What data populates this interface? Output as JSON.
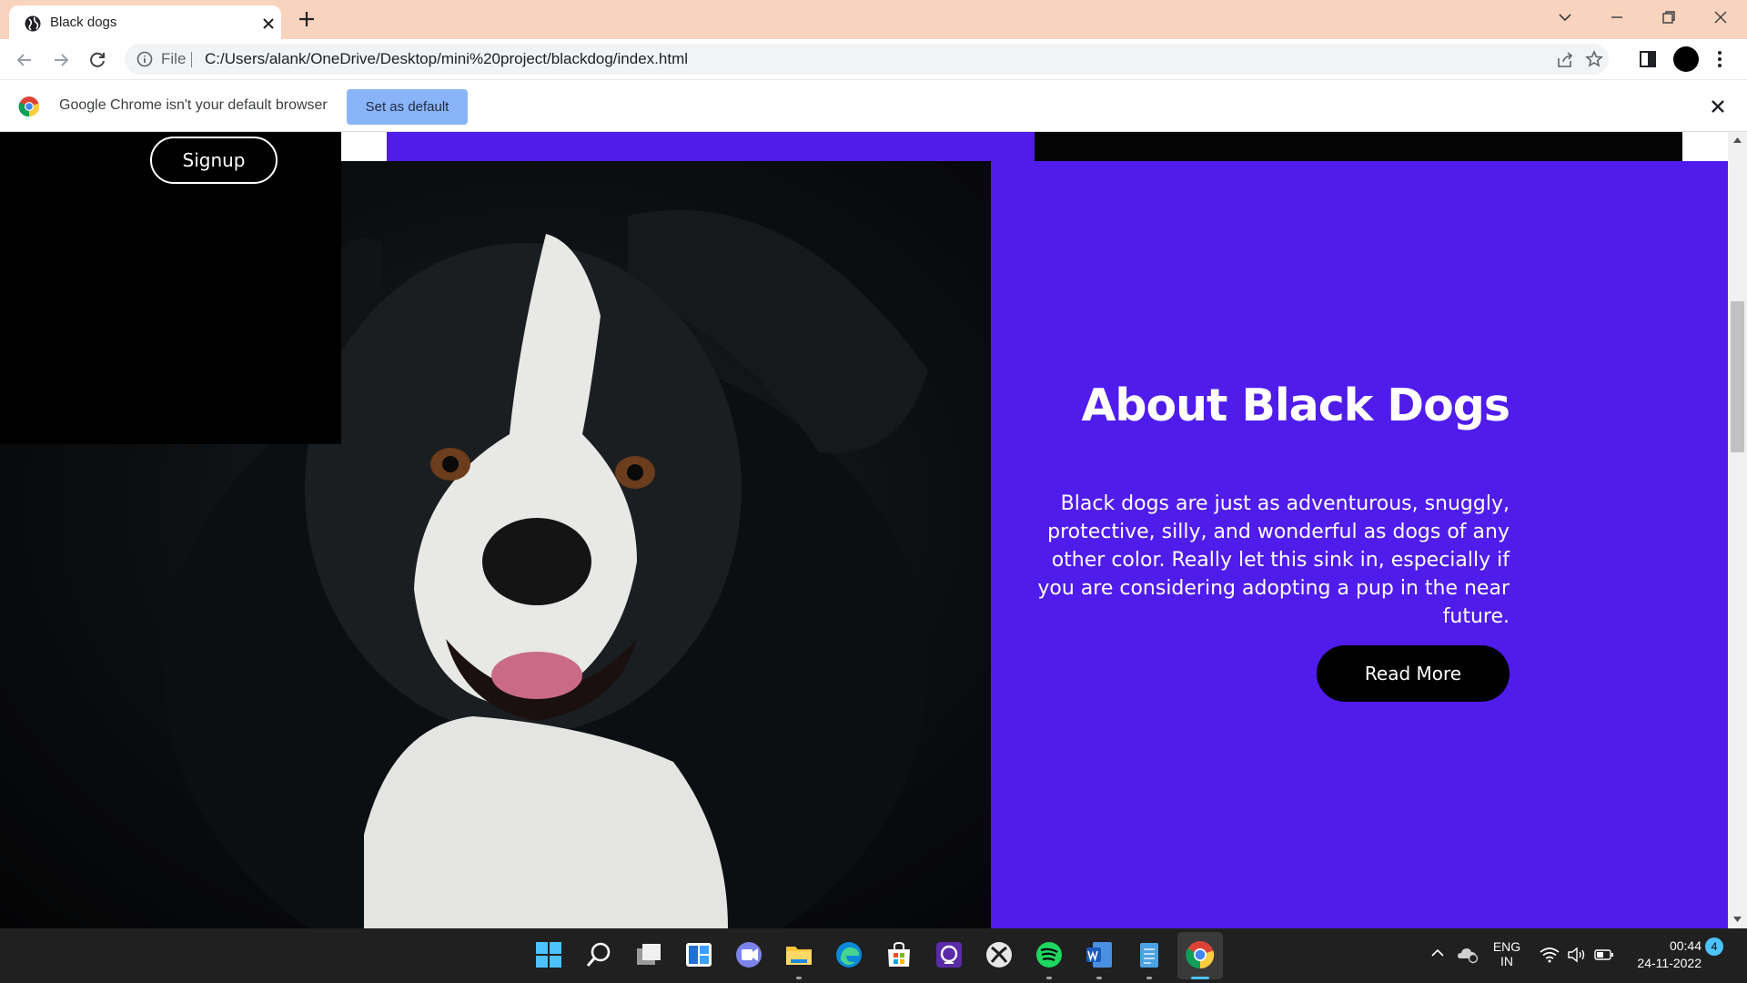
{
  "browser": {
    "tab_title": "Black dogs",
    "address_scheme": "File",
    "address_url": "C:/Users/alank/OneDrive/Desktop/mini%20project/blackdog/index.html",
    "icons": [
      "back-icon",
      "forward-icon",
      "reload-icon",
      "info-icon",
      "share-icon",
      "star-icon",
      "side-panel-icon",
      "menu-icon"
    ]
  },
  "infobar": {
    "message": "Google Chrome isn't your default browser",
    "button_label": "Set as default"
  },
  "page": {
    "signup_label": "Signup",
    "about_title": "About Black Dogs",
    "about_text": "Black dogs are just as adventurous, snuggly, protective, silly, and wonderful as dogs of any other color. Really let this sink in, especially if you are considering adopting a pup in the near future.",
    "read_more_label": "Read More",
    "colors": {
      "accent": "#501ceb",
      "dark": "#000000"
    }
  },
  "taskbar": {
    "apps": [
      "start-icon",
      "search-icon",
      "task-view-icon",
      "widgets-icon",
      "teams-chat-icon",
      "file-explorer-icon",
      "edge-icon",
      "store-icon",
      "app-icon",
      "xbox-icon",
      "spotify-icon",
      "word-icon",
      "notepad-icon",
      "chrome-icon"
    ],
    "language_line1": "ENG",
    "language_line2": "IN",
    "time": "00:44",
    "date": "24-11-2022",
    "notification_count": "4"
  }
}
